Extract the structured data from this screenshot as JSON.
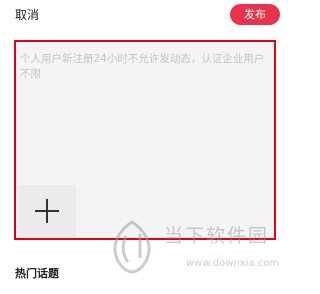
{
  "header": {
    "cancel_label": "取消",
    "publish_label": "发布"
  },
  "compose": {
    "placeholder": "个人用户新注册24小时不允许发动态，认证企业用户不限",
    "value": ""
  },
  "add_media": {
    "icon": "plus-icon"
  },
  "hot_topics": {
    "title": "热门话题"
  },
  "watermark": {
    "title": "当下软件园",
    "url": "www.downxia.com"
  },
  "colors": {
    "accent": "#e8334a",
    "highlight_border": "#e60012"
  }
}
